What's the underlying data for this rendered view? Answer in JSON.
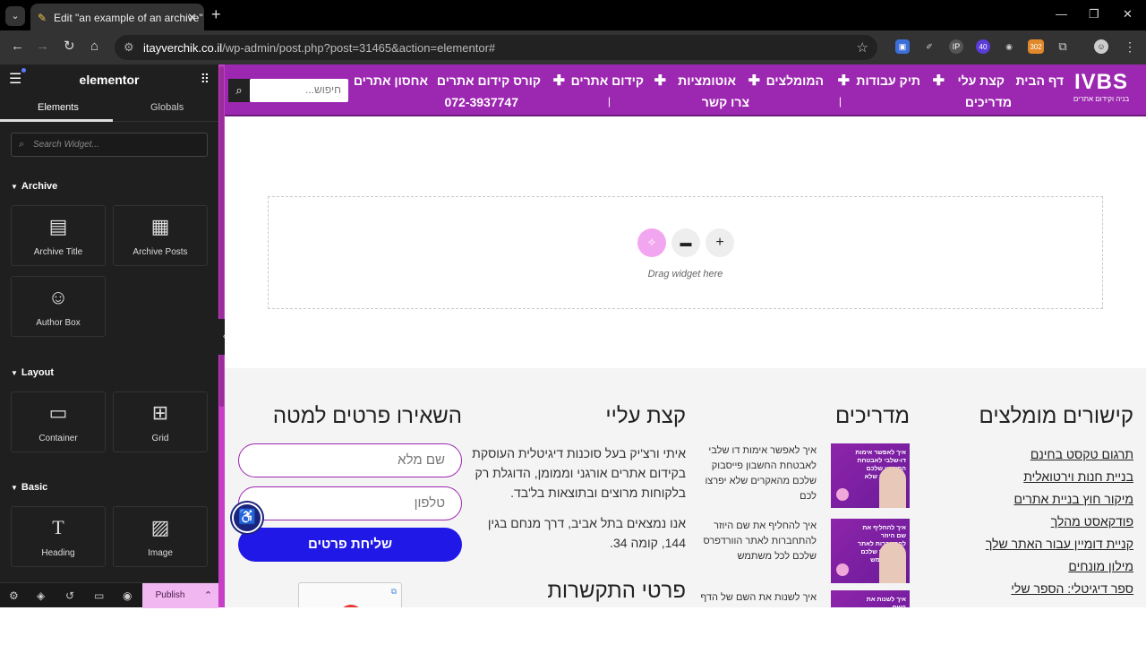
{
  "browser": {
    "tab_title": "Edit \"an example of an archive\"",
    "url_host": "itayverchik.co.il",
    "url_path": "/wp-admin/post.php?post=31465&action=elementor#",
    "ext_badge_1": "40",
    "ext_badge_2": "302"
  },
  "panel": {
    "logo": "elementor",
    "tabs": [
      "Elements",
      "Globals"
    ],
    "search_placeholder": "Search Widget...",
    "categories": {
      "archive": "Archive",
      "layout": "Layout",
      "basic": "Basic"
    },
    "widgets": {
      "archive_title": "Archive Title",
      "archive_posts": "Archive Posts",
      "author_box": "Author Box",
      "container": "Container",
      "grid": "Grid",
      "heading": "Heading",
      "image": "Image"
    },
    "publish_label": "Publish"
  },
  "site": {
    "brand_name": "IVBS",
    "brand_tagline": "בניה וקידום אתרים",
    "menu": {
      "home": "דף הבית",
      "about": "קצת עלי",
      "portfolio": "תיק עבודות",
      "recommended": "המומלצים",
      "automations": "אוטומציות",
      "seo": "קידום אתרים",
      "seo_course": "קורס קידום אתרים",
      "hosting": "אחסון אתרים",
      "guides": "מדריכים",
      "contact": "צרו קשר",
      "phone": "072-3937747"
    },
    "search_placeholder": "חיפוש...",
    "dropzone_text": "Drag widget here",
    "columns": {
      "links_title": "קישורים מומלצים",
      "guides_title": "מדריכים",
      "about_title": "קצת עליי",
      "form_title": "השאירו פרטים למטה",
      "contact_title": "פרטי התקשרות"
    },
    "links": [
      "תרגום טקסט בחינם",
      "בניית חנות וירטואלית",
      "מיקור חוץ בניית אתרים",
      "פודקאסט מהלך",
      "קניית דומיין עבור האתר שלך",
      "מילון מונחים",
      "ספר דיגיטלי: הספר שלי"
    ],
    "posts": [
      {
        "text": "איך לאפשר אימות דו שלבי לאבטחת החשבון פייסבוק שלכם מהאקרים שלא יפרצו לכם",
        "thumb": "איך לאפשר אימות דו-שלבי לאבטחת החשבון שלכם מהאקרים שלא יפרצו"
      },
      {
        "text": "איך להחליף את שם היוזר להתחברות לאתר הוורדפרס שלכם לכל משתמש",
        "thumb": "איך להחליף את שם היוזר להתחברות לאתר הוורדפרס שלכם לכל משתמש"
      },
      {
        "text": "איך לשנות את השם של הדף",
        "thumb": "איך לשנות את השם"
      }
    ],
    "about_p1": "איתי ורצ'יק בעל סוכנות דיגיטלית העוסקת בקידום אתרים אורגני וממומן, הדוגלת רק בלקוחות מרוצים ובתוצאות בל'בד.",
    "about_p2": "אנו נמצאים בתל אביב, דרך מנחם בגין 144, קומה 34.",
    "form": {
      "name_placeholder": "שם מלא",
      "phone_placeholder": "טלפון",
      "submit": "שליחת פרטים"
    }
  },
  "colors": {
    "site_purple": "#9c27b0",
    "submit_blue": "#2018e6",
    "publish_pink": "#f0b7f0"
  }
}
